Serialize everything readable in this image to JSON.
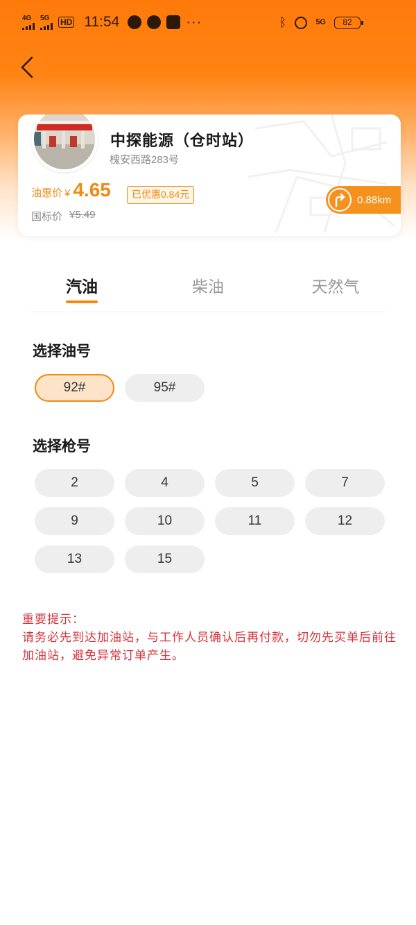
{
  "status_bar": {
    "net1": "4G",
    "net2": "5G",
    "hd": "HD",
    "time": "11:54",
    "net5g": "5G",
    "battery": "82",
    "icons": [
      "signal-icon",
      "compass-icon",
      "wechat-icon",
      "app-icon",
      "bluetooth-icon",
      "alarm-icon"
    ]
  },
  "nav": {
    "back_icon": "chevron-left-icon"
  },
  "station": {
    "name": "中探能源（仓时站）",
    "address": "槐安西路283号",
    "price_label": "油惠价",
    "currency": "¥",
    "price": "4.65",
    "discount": "已优惠0.84元",
    "ref_label": "国标价",
    "ref_price": "¥5.49",
    "distance": "0.88km"
  },
  "tabs": [
    "汽油",
    "柴油",
    "天然气"
  ],
  "active_tab": 0,
  "oil_section": {
    "title": "选择油号",
    "options": [
      "92#",
      "95#"
    ],
    "selected": "92#"
  },
  "gun_section": {
    "title": "选择枪号",
    "options": [
      "2",
      "4",
      "5",
      "7",
      "9",
      "10",
      "11",
      "12",
      "13",
      "15"
    ]
  },
  "notice": {
    "title": "重要提示：",
    "body": "请务必先到达加油站，与工作人员确认后再付款，切勿先买单后前往加油站，避免异常订单产生。"
  },
  "colors": {
    "accent": "#f08a12",
    "header": "#ff7a0a",
    "notice": "#d8323a"
  }
}
